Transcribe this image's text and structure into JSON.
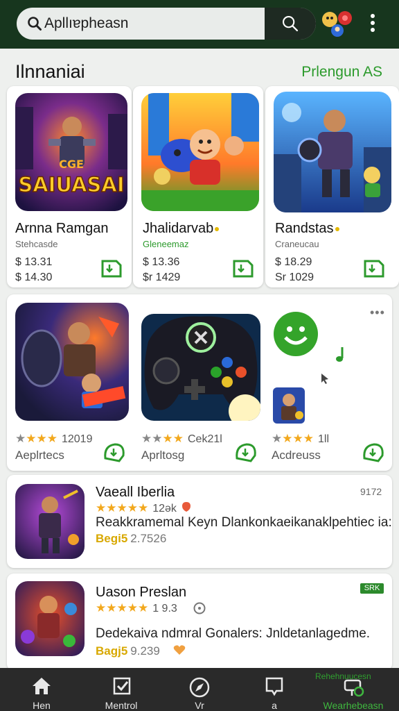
{
  "search": {
    "text": "Apllıɐpheasn"
  },
  "section1": {
    "title": "Ilnnaniai",
    "link": "Prlengun AS",
    "apps": [
      {
        "name": "Arnna Ramgan",
        "subtitle": "Stehcasde",
        "price1": "$ 13.31",
        "price2": "$ 14.30",
        "game_title": "SAIUASAI",
        "game_small": "CGE"
      },
      {
        "name": "Jhalidarvab",
        "subtitle": "Gleneemaz",
        "price1": "$ 13.36",
        "price2": "$r 1429"
      },
      {
        "name": "Randstas",
        "subtitle": "Craneucau",
        "price1": "$ 18.29",
        "price2": "Sr 1029"
      }
    ]
  },
  "section2": {
    "items": [
      {
        "stars": 3,
        "rating": "12019",
        "status": "Aeplrtecs"
      },
      {
        "stars": 3,
        "rating": "Cek21l",
        "status": "Aprltosg"
      },
      {
        "stars": 3,
        "rating": "1ll",
        "status": "Acdreuss"
      }
    ]
  },
  "list": [
    {
      "name": "Vaeall Iberlia",
      "stars_text": "★★★★★",
      "rating": "12ək",
      "desc": "Reakkramemal Keyn Dlankonkaeikanaklpehtiec ia:",
      "meta_hl": "Begi5",
      "meta_num": "2.7526",
      "right": "9172"
    },
    {
      "name": "Uason Preslan",
      "stars_text": "★★★★★",
      "rating": "1 9.3",
      "desc": "Dedekaiva ndmral Gonalers: Jnldetanlagedme.",
      "meta_hl": "Bagj5",
      "meta_num": "9.239",
      "right": "SRK"
    }
  ],
  "bottom_nav": {
    "top_label": "Rehehnuucesn",
    "items": [
      {
        "label": "Hen",
        "icon": "home-icon"
      },
      {
        "label": "Mentrol",
        "icon": "checklist-icon"
      },
      {
        "label": "Vr",
        "icon": "compass-icon"
      },
      {
        "label": "a",
        "icon": "chat-icon"
      },
      {
        "label": "Wearhebeasn",
        "icon": "account-settings-icon"
      }
    ]
  },
  "colors": {
    "topbar": "#17361e",
    "accent": "#2b9a2b",
    "star": "#f2a81d",
    "nav": "#2a2a2a"
  }
}
